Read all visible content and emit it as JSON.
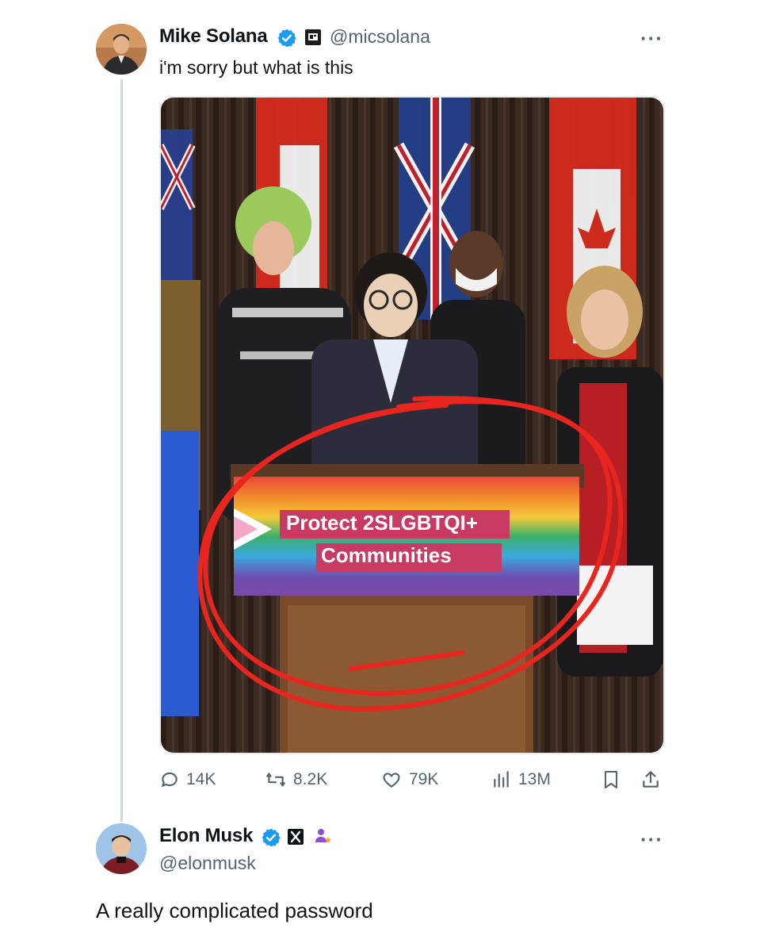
{
  "tweet1": {
    "name": "Mike Solana",
    "handle": "@micsolana",
    "text": "i'm sorry but what is this",
    "more": "···",
    "stats": {
      "replies": "14K",
      "retweets": "8.2K",
      "likes": "79K",
      "views": "13M"
    },
    "media": {
      "sign_line1": "Protect 2SLGBTQI+",
      "sign_line2": "Communities"
    }
  },
  "tweet2": {
    "name": "Elon Musk",
    "handle": "@elonmusk",
    "text": "A really complicated password",
    "more": "···"
  },
  "colors": {
    "verified": "#1d9bf0",
    "muted": "#536471",
    "circle": "#e8251f"
  },
  "icons": [
    "verified-badge-icon",
    "affiliate-badge-icon",
    "x-logo-icon",
    "reply-icon",
    "retweet-icon",
    "like-icon",
    "views-icon",
    "bookmark-icon",
    "share-icon",
    "more-icon"
  ]
}
